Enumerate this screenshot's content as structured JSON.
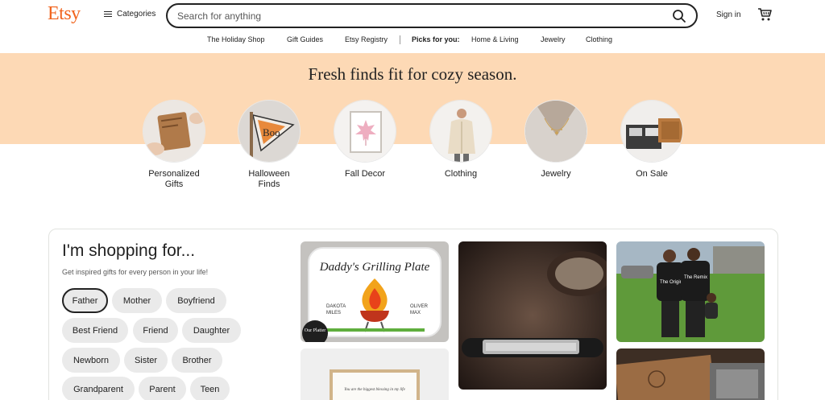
{
  "header": {
    "logo": "Etsy",
    "categories_label": "Categories",
    "search_placeholder": "Search for anything",
    "signin_label": "Sign in"
  },
  "nav": {
    "items": [
      "The Holiday Shop",
      "Gift Guides",
      "Etsy Registry"
    ],
    "picks_label": "Picks for you:",
    "picks": [
      "Home & Living",
      "Jewelry",
      "Clothing"
    ]
  },
  "banner": {
    "title": "Fresh finds fit for cozy season.",
    "background_color": "#fdd9b5"
  },
  "categories": [
    {
      "label": "Personalized Gifts",
      "line1": "Personalized",
      "line2": "Gifts"
    },
    {
      "label": "Halloween Finds",
      "line1": "Halloween",
      "line2": "Finds"
    },
    {
      "label": "Fall Decor",
      "line1": "Fall Decor",
      "line2": ""
    },
    {
      "label": "Clothing",
      "line1": "Clothing",
      "line2": ""
    },
    {
      "label": "Jewelry",
      "line1": "Jewelry",
      "line2": ""
    },
    {
      "label": "On Sale",
      "line1": "On Sale",
      "line2": ""
    }
  ],
  "shopping": {
    "title": "I'm shopping for...",
    "subtitle": "Get inspired gifts for every person in your life!",
    "chips": [
      "Father",
      "Mother",
      "Boyfriend",
      "Best Friend",
      "Friend",
      "Daughter",
      "Newborn",
      "Sister",
      "Brother",
      "Grandparent",
      "Parent",
      "Teen"
    ],
    "selected": "Father"
  },
  "products": {
    "grilling_plate_title": "Daddy's Grilling Plate",
    "names_left": [
      "DAKOTA",
      "MILES"
    ],
    "names_right": [
      "OLIVER",
      "MAX"
    ],
    "badge": "Our Platter",
    "shirt_left": "The Original",
    "shirt_right": "The Remix",
    "frame_text": "You are the biggest blessing in my life"
  },
  "colors": {
    "brand": "#f1641e",
    "text": "#222222"
  }
}
